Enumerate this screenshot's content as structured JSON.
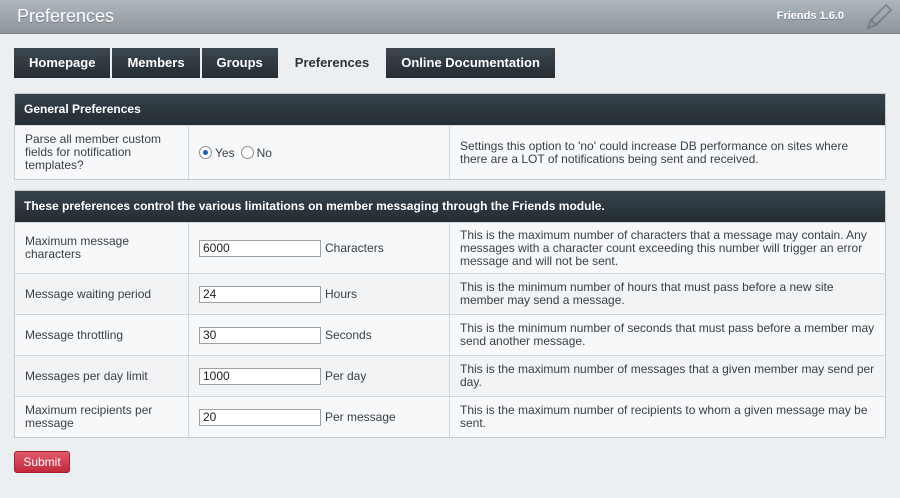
{
  "window": {
    "title": "Preferences",
    "version": "Friends 1.6.0"
  },
  "tabs": [
    {
      "label": "Homepage"
    },
    {
      "label": "Members"
    },
    {
      "label": "Groups"
    },
    {
      "label": "Preferences",
      "active": true
    },
    {
      "label": "Online Documentation"
    }
  ],
  "general": {
    "header": "General Preferences",
    "row": {
      "label": "Parse all member custom fields for notification templates?",
      "yes_label": "Yes",
      "no_label": "No",
      "selected": "Yes",
      "description": "Settings this option to 'no' could increase DB performance on sites where there are a LOT of notifications being sent and received."
    }
  },
  "messaging": {
    "header": "These preferences control the various limitations on member messaging through the Friends module.",
    "rows": [
      {
        "label": "Maximum message characters",
        "value": "6000",
        "unit": "Characters",
        "description": "This is the maximum number of characters that a message may contain. Any messages with a character count exceeding this number will trigger an error message and will not be sent."
      },
      {
        "label": "Message waiting period",
        "value": "24",
        "unit": "Hours",
        "description": "This is the minimum number of hours that must pass before a new site member may send a message."
      },
      {
        "label": "Message throttling",
        "value": "30",
        "unit": "Seconds",
        "description": "This is the minimum number of seconds that must pass before a member may send another message."
      },
      {
        "label": "Messages per day limit",
        "value": "1000",
        "unit": "Per day",
        "description": "This is the maximum number of messages that a given member may send per day."
      },
      {
        "label": "Maximum recipients per message",
        "value": "20",
        "unit": "Per message",
        "description": "This is the maximum number of recipients to whom a given message may be sent."
      }
    ]
  },
  "submit_label": "Submit",
  "colors": {
    "header_bg": "#2b343b",
    "submit_bg": "#d03a4e",
    "accent_radio": "#1d5fb8"
  }
}
